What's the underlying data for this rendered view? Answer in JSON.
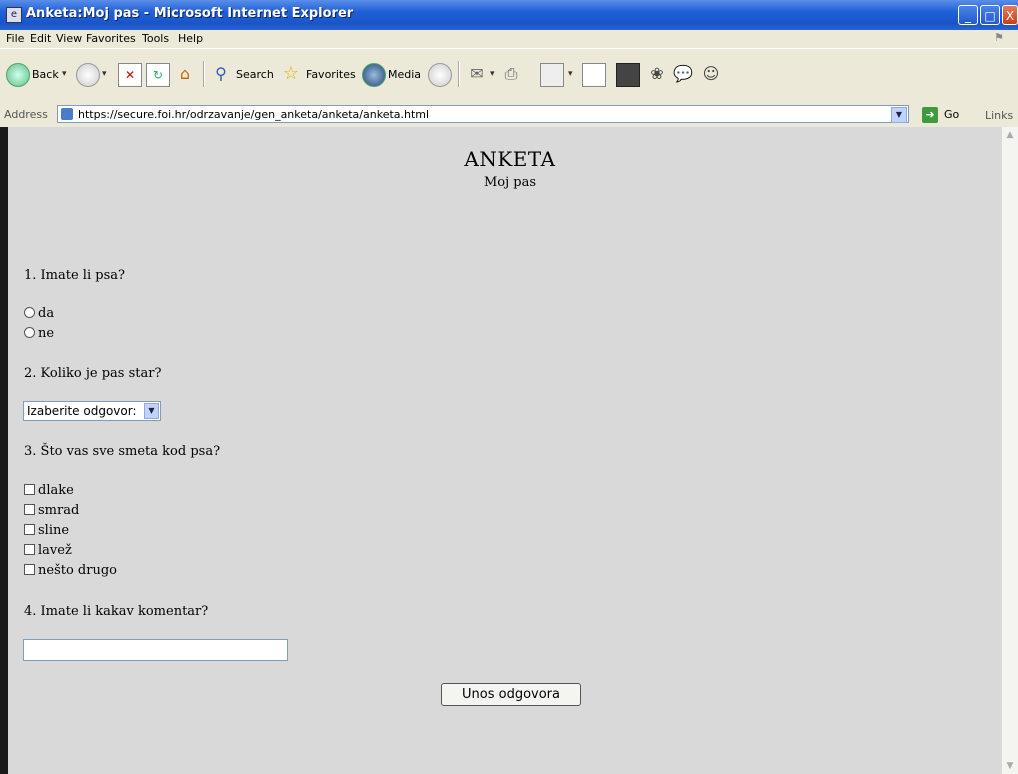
{
  "window": {
    "title": "Anketa:Moj pas - Microsoft Internet Explorer",
    "controls": {
      "minimize": "_",
      "maximize": "□",
      "close": "X"
    }
  },
  "menu": [
    "File",
    "Edit",
    "View",
    "Favorites",
    "Tools",
    "Help"
  ],
  "toolbar": {
    "back_label": "Back",
    "search_label": "Search",
    "favorites_label": "Favorites",
    "media_label": "Media"
  },
  "address": {
    "label": "Address",
    "url": "https://secure.foi.hr/odrzavanje/gen_anketa/anketa/anketa.html",
    "go_label": "Go",
    "links_label": "Links"
  },
  "page": {
    "title": "ANKETA",
    "subtitle": "Moj pas",
    "questions": [
      {
        "text": "1. Imate li psa?",
        "type": "radio",
        "options": [
          "da",
          "ne"
        ]
      },
      {
        "text": "2. Koliko je pas star?",
        "type": "select",
        "selected": "Izaberite odgovor:"
      },
      {
        "text": "3. Što vas sve smeta kod psa?",
        "type": "checkbox",
        "options": [
          "dlake",
          "smrad",
          "sline",
          "lavež",
          "nešto drugo"
        ]
      },
      {
        "text": "4. Imate li kakav komentar?",
        "type": "text",
        "value": ""
      }
    ],
    "submit_label": "Unos odgovora"
  }
}
